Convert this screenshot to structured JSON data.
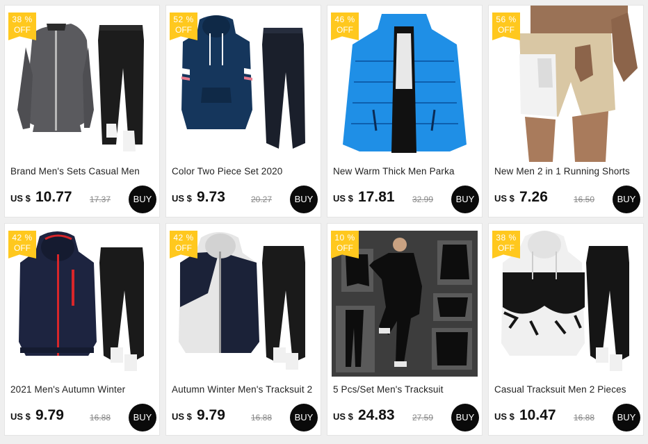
{
  "products": [
    {
      "discount_pct": "38 %",
      "discount_off": "OFF",
      "title": "Brand Men's Sets Casual Men",
      "currency": "US $",
      "price": "10.77",
      "old_price": "17.37",
      "buy_label": "BUY",
      "image": "grey-zip-jacket-black-pants",
      "colors": {
        "main": "#5a5a5e",
        "second": "#1c1c1c"
      }
    },
    {
      "discount_pct": "52 %",
      "discount_off": "OFF",
      "title": "Color Two Piece Set 2020",
      "currency": "US $",
      "price": "9.73",
      "old_price": "20.27",
      "buy_label": "BUY",
      "image": "navy-hoodie-navy-pants",
      "colors": {
        "main": "#15365c",
        "second": "#1a1f2b"
      }
    },
    {
      "discount_pct": "46 %",
      "discount_off": "OFF",
      "title": "New Warm Thick Men Parka",
      "currency": "US $",
      "price": "17.81",
      "old_price": "32.99",
      "buy_label": "BUY",
      "image": "blue-puffer-jacket",
      "colors": {
        "main": "#1f8fe6",
        "second": "#0d5fae"
      }
    },
    {
      "discount_pct": "56 %",
      "discount_off": "OFF",
      "title": "New Men 2 in 1 Running Shorts",
      "currency": "US $",
      "price": "7.26",
      "old_price": "16.50",
      "buy_label": "BUY",
      "image": "camo-running-shorts",
      "colors": {
        "main": "#d9c7a4",
        "second": "#f2f2f2"
      }
    },
    {
      "discount_pct": "42 %",
      "discount_off": "OFF",
      "title": "2021 Men's Autumn Winter",
      "currency": "US $",
      "price": "9.79",
      "old_price": "16.88",
      "buy_label": "BUY",
      "image": "navy-red-zip-hoodie-black-pants",
      "colors": {
        "main": "#1d2440",
        "second": "#1a1a1a"
      }
    },
    {
      "discount_pct": "42 %",
      "discount_off": "OFF",
      "title": "Autumn Winter Men's Tracksuit 2",
      "currency": "US $",
      "price": "9.79",
      "old_price": "16.88",
      "buy_label": "BUY",
      "image": "white-navy-hoodie-black-pants",
      "colors": {
        "main": "#e6e6e6",
        "second": "#1b2238"
      }
    },
    {
      "discount_pct": "10 %",
      "discount_off": "OFF",
      "title": "5 Pcs/Set Men's Tracksuit",
      "currency": "US $",
      "price": "24.83",
      "old_price": "27.59",
      "buy_label": "BUY",
      "image": "black-sport-compression-set",
      "colors": {
        "main": "#3d3d3d",
        "second": "#0d0d0d"
      }
    },
    {
      "discount_pct": "38 %",
      "discount_off": "OFF",
      "title": "Casual Tracksuit Men 2 Pieces",
      "currency": "US $",
      "price": "10.47",
      "old_price": "16.88",
      "buy_label": "BUY",
      "image": "white-black-splash-hoodie-black-pants",
      "colors": {
        "main": "#f0f0f0",
        "second": "#151515"
      }
    }
  ]
}
